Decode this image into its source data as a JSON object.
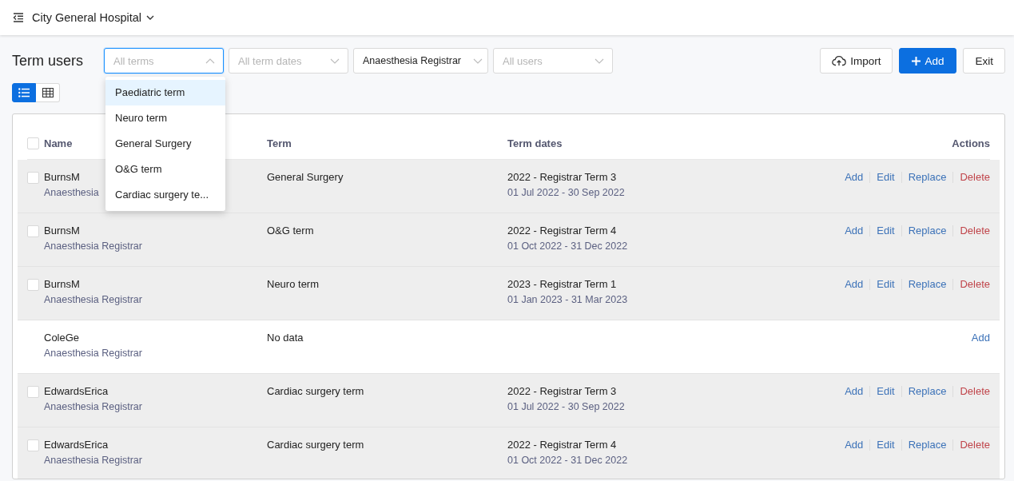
{
  "header": {
    "title": "City General Hospital"
  },
  "toolbar": {
    "title": "Term users",
    "filters": [
      {
        "placeholder": "All terms",
        "open": true
      },
      {
        "placeholder": "All term dates",
        "open": false
      },
      {
        "value": "Anaesthesia Registrar",
        "open": false
      },
      {
        "placeholder": "All users",
        "open": false
      }
    ],
    "buttons": [
      {
        "label": "Import",
        "kind": "import"
      },
      {
        "label": "Add",
        "kind": "primary"
      },
      {
        "label": "Exit",
        "kind": "default"
      }
    ]
  },
  "view_toggle": [
    {
      "kind": "list",
      "selected": true
    },
    {
      "kind": "grid",
      "selected": false
    }
  ],
  "dropdown": [
    {
      "label": "Paediatric term",
      "highlighted": true
    },
    {
      "label": "Neuro term",
      "highlighted": false
    },
    {
      "label": "General Surgery",
      "highlighted": false
    },
    {
      "label": "O&G term",
      "highlighted": false
    },
    {
      "label": "Cardiac surgery te...",
      "highlighted": false
    }
  ],
  "table": {
    "select_all_checked": false,
    "columns": [
      "Name",
      "Term",
      "Term dates",
      "Actions"
    ],
    "rows": [
      {
        "checked": false,
        "shaded": true,
        "name": "BurnsM",
        "role": "Anaesthesia",
        "term": "General Surgery",
        "term_name": "2022 - Registrar Term 3",
        "dates": "01 Jul 2022 - 30 Sep 2022",
        "actions": [
          {
            "label": "Add",
            "kind": "link"
          },
          {
            "label": "Edit",
            "kind": "link"
          },
          {
            "label": "Replace",
            "kind": "link"
          },
          {
            "label": "Delete",
            "kind": "danger"
          }
        ]
      },
      {
        "checked": false,
        "shaded": true,
        "name": "BurnsM",
        "role": "Anaesthesia Registrar",
        "term": "O&G term",
        "term_name": "2022 - Registrar Term 4",
        "dates": "01 Oct 2022 - 31 Dec 2022",
        "actions": [
          {
            "label": "Add",
            "kind": "link"
          },
          {
            "label": "Edit",
            "kind": "link"
          },
          {
            "label": "Replace",
            "kind": "link"
          },
          {
            "label": "Delete",
            "kind": "danger"
          }
        ]
      },
      {
        "checked": false,
        "shaded": true,
        "name": "BurnsM",
        "role": "Anaesthesia Registrar",
        "term": "Neuro term",
        "term_name": "2023 - Registrar Term 1",
        "dates": "01 Jan 2023 - 31 Mar 2023",
        "actions": [
          {
            "label": "Add",
            "kind": "link"
          },
          {
            "label": "Edit",
            "kind": "link"
          },
          {
            "label": "Replace",
            "kind": "link"
          },
          {
            "label": "Delete",
            "kind": "danger"
          }
        ]
      },
      {
        "shaded": false,
        "name": "ColeGe",
        "role": "Anaesthesia Registrar",
        "term": "No data",
        "actions": [
          {
            "label": "Add",
            "kind": "link"
          }
        ]
      },
      {
        "checked": false,
        "shaded": true,
        "name": "EdwardsErica",
        "role": "Anaesthesia Registrar",
        "term": "Cardiac surgery term",
        "term_name": "2022 - Registrar Term 3",
        "dates": "01 Jul 2022 - 30 Sep 2022",
        "actions": [
          {
            "label": "Add",
            "kind": "link"
          },
          {
            "label": "Edit",
            "kind": "link"
          },
          {
            "label": "Replace",
            "kind": "link"
          },
          {
            "label": "Delete",
            "kind": "danger"
          }
        ]
      },
      {
        "checked": false,
        "shaded": true,
        "name": "EdwardsErica",
        "role": "Anaesthesia Registrar",
        "term": "Cardiac surgery term",
        "term_name": "2022 - Registrar Term 4",
        "dates": "01 Oct 2022 - 31 Dec 2022",
        "actions": [
          {
            "label": "Add",
            "kind": "link"
          },
          {
            "label": "Edit",
            "kind": "link"
          },
          {
            "label": "Replace",
            "kind": "link"
          },
          {
            "label": "Delete",
            "kind": "danger"
          }
        ]
      }
    ]
  }
}
